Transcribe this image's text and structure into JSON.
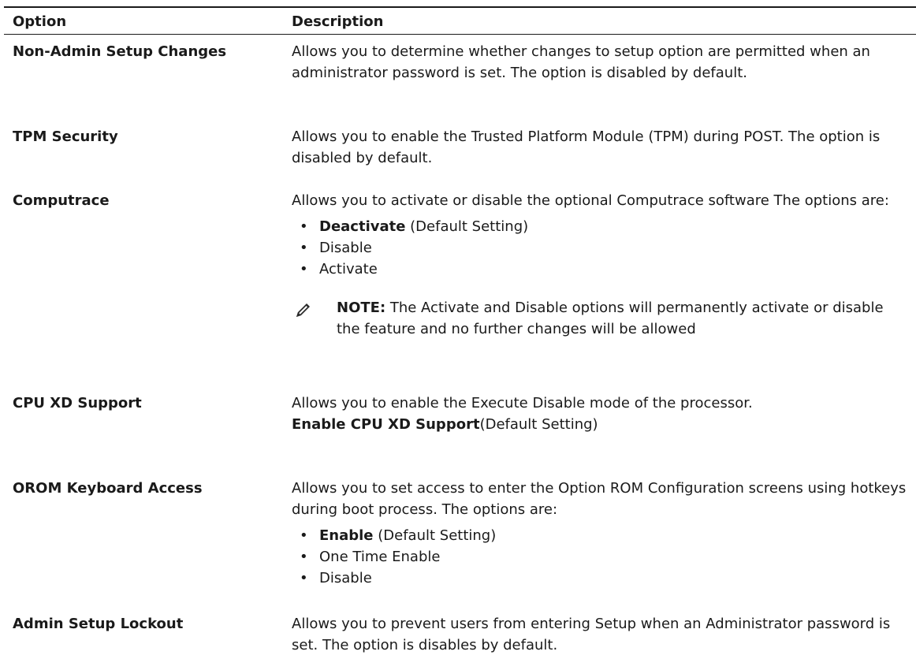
{
  "header": {
    "col_option": "Option",
    "col_description": "Description"
  },
  "rows": [
    {
      "option": "Non-Admin Setup Changes",
      "desc": "Allows you to determine whether changes to setup option are permitted when an administrator password is set. The option is disabled by default."
    },
    {
      "option": "TPM Security",
      "desc": "Allows you to enable the Trusted Platform Module (TPM) during POST. The option is disabled by default."
    },
    {
      "option": "Computrace",
      "desc": "Allows you to activate or disable the optional Computrace software The options are:",
      "bullets": [
        {
          "bold": "Deactivate",
          "rest": " (Default Setting)"
        },
        {
          "bold": "",
          "rest": "Disable"
        },
        {
          "bold": "",
          "rest": "Activate"
        }
      ],
      "note_label": "NOTE:",
      "note_text": " The Activate and Disable options will permanently activate or disable the feature and no further changes will be allowed",
      "note_icon": "pencil-note-icon"
    },
    {
      "option": "CPU XD Support",
      "desc": "Allows you to enable the Execute Disable mode of the processor.",
      "extra_bold": "Enable CPU XD Support",
      "extra_rest": "(Default Setting)"
    },
    {
      "option": "OROM Keyboard Access",
      "desc": "Allows you to set access to enter the Option ROM Configuration screens using hotkeys during boot process. The options are:",
      "bullets": [
        {
          "bold": "Enable",
          "rest": " (Default Setting)"
        },
        {
          "bold": "",
          "rest": "One Time Enable"
        },
        {
          "bold": "",
          "rest": "Disable"
        }
      ]
    },
    {
      "option": "Admin Setup Lockout",
      "desc": "Allows you to prevent users from entering Setup when an Administrator password is set. The option is disables by default."
    }
  ],
  "bullet_char": "•"
}
